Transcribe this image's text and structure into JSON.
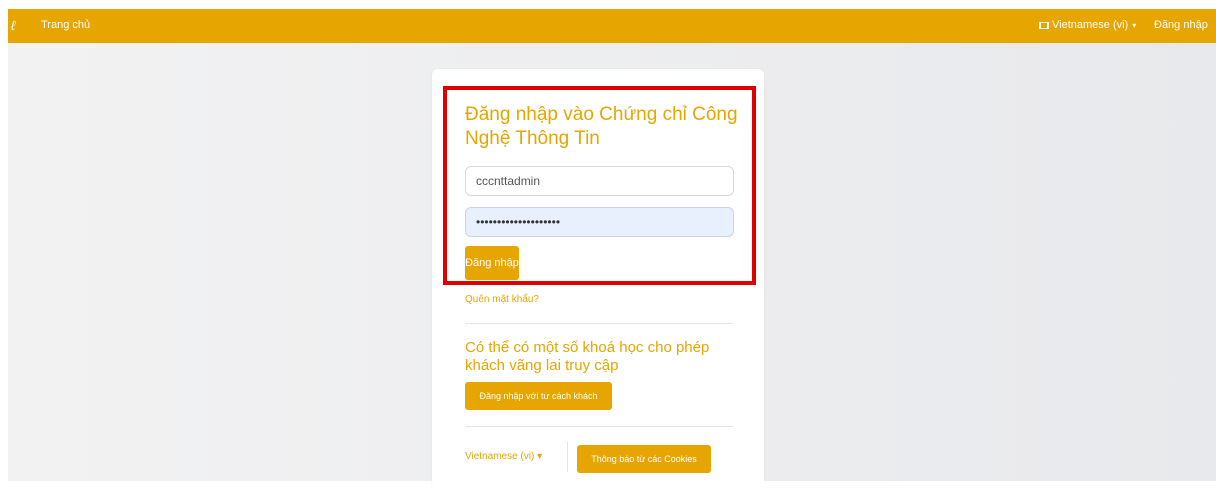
{
  "navbar": {
    "logo_icon": "logo-icon",
    "home_label": "Trang chủ",
    "language_label": "Vietnamese (vi)",
    "login_label": "Đăng nhập"
  },
  "login_form": {
    "title": "Đăng nhập vào Chứng chỉ Công Nghệ Thông Tin",
    "username_value": "cccnttadmin",
    "password_value": "••••••••••••••••••••",
    "submit_label": "Đăng nhập",
    "forgot_password": "Quên mật khẩu?"
  },
  "guest": {
    "title": "Có thể có một số khoá học cho phép khách vãng lai truy cập",
    "button_label": "Đăng nhập với tư cách khách"
  },
  "footer": {
    "language_label": "Vietnamese (vi)",
    "cookies_label": "Thông báo từ các Cookies"
  },
  "colors": {
    "brand": "#e6a500",
    "highlight": "#e00000",
    "autofill": "#e8f0fe"
  }
}
